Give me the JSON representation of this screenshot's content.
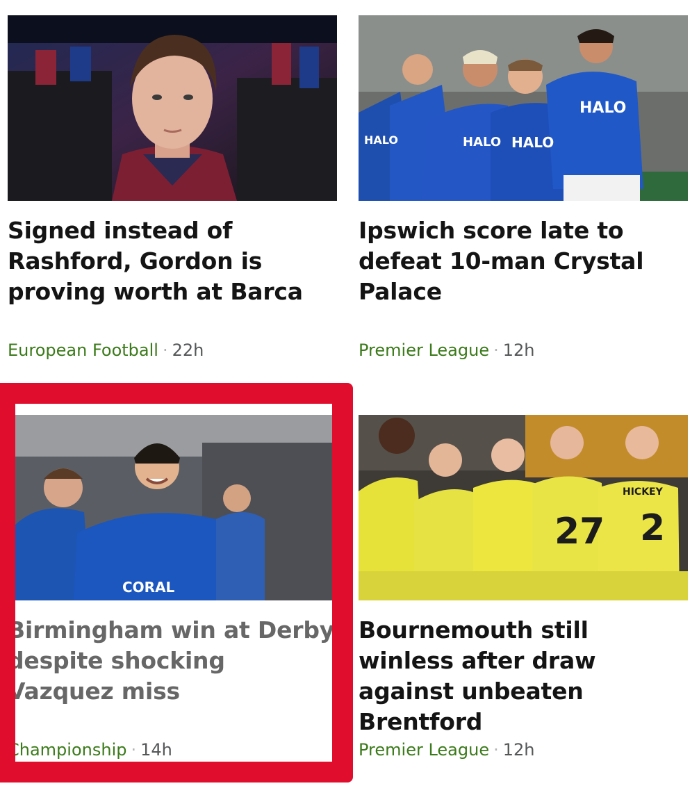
{
  "cards": [
    {
      "headline": "Signed instead of Rashford, Gordon is proving worth at Barca",
      "section": "European Football",
      "age": "22h",
      "image": "football-player-portrait"
    },
    {
      "headline": "Ipswich score late to defeat 10-man Crystal Palace",
      "section": "Premier League",
      "age": "12h",
      "image": "ipswich-players-celebrating",
      "shirt_text": "HALO"
    },
    {
      "headline": "Birmingham win at Derby despite shocking Vazquez miss",
      "section": "Championship",
      "age": "14h",
      "image": "birmingham-player-celebrating",
      "shirt_text": "CORAL"
    },
    {
      "headline": "Bournemouth still winless after draw against unbeaten Brentford",
      "section": "Premier League",
      "age": "12h",
      "image": "bournemouth-players-huddle",
      "shirt_numbers": [
        "27",
        "2"
      ],
      "shirt_name": "HICKEY"
    }
  ],
  "colors": {
    "section_text": "#3b7a1a",
    "meta_text": "#545658",
    "headline_text": "#141414",
    "highlight_frame": "#e00d2d"
  }
}
